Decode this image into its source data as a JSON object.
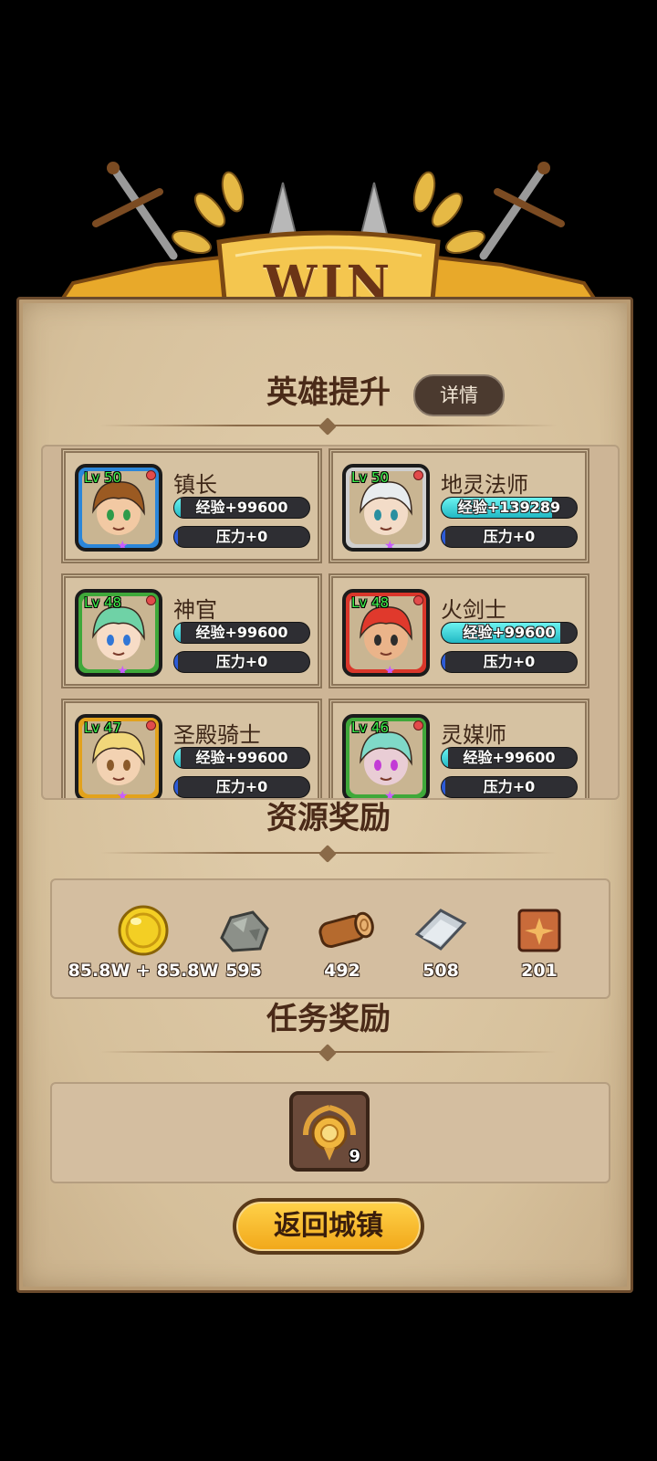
{
  "banner": {
    "title": "WIN"
  },
  "hero_section": {
    "title": "英雄提升",
    "detail_button": "详情",
    "heroes": [
      {
        "name": "镇长",
        "level": "Lv 50",
        "exp": "经验+99600",
        "exp_fill": 0.05,
        "pressure": "压力+0",
        "frame": "#2b86d9",
        "hair": "#9b5a22",
        "skin": "#f2c9a3",
        "eyes": "#2e9b4a"
      },
      {
        "name": "地灵法师",
        "level": "Lv 50",
        "exp": "经验+139289",
        "exp_fill": 0.82,
        "pressure": "压力+0",
        "frame": "#cfcfcf",
        "hair": "#e8ecef",
        "skin": "#f3dcc8",
        "eyes": "#2a8fa0"
      },
      {
        "name": "神官",
        "level": "Lv 48",
        "exp": "经验+99600",
        "exp_fill": 0.05,
        "pressure": "压力+0",
        "frame": "#3fa83a",
        "hair": "#6fd2a6",
        "skin": "#f7dcc6",
        "eyes": "#3076d6"
      },
      {
        "name": "火剑士",
        "level": "Lv 48",
        "exp": "经验+99600",
        "exp_fill": 0.88,
        "pressure": "压力+0",
        "frame": "#d9362a",
        "hair": "#e0392c",
        "skin": "#eab48a",
        "eyes": "#2d2d2d"
      },
      {
        "name": "圣殿骑士",
        "level": "Lv 47",
        "exp": "经验+99600",
        "exp_fill": 0.05,
        "pressure": "压力+0",
        "frame": "#e2a21c",
        "hair": "#f1d77a",
        "skin": "#f3d2b2",
        "eyes": "#8a5a2a"
      },
      {
        "name": "灵媒师",
        "level": "Lv 46",
        "exp": "经验+99600",
        "exp_fill": 0.05,
        "pressure": "压力+0",
        "frame": "#3fa83a",
        "hair": "#7fd9c8",
        "skin": "#e9cdd5",
        "eyes": "#c33bd6"
      }
    ]
  },
  "resource_section": {
    "title": "资源奖励",
    "items": [
      {
        "icon": "gold-coin-icon",
        "value": "85.8W + 85.8W"
      },
      {
        "icon": "ore-icon",
        "value": "595"
      },
      {
        "icon": "wood-log-icon",
        "value": "492"
      },
      {
        "icon": "steel-plate-icon",
        "value": "508"
      },
      {
        "icon": "scroll-icon",
        "value": "201"
      }
    ]
  },
  "task_section": {
    "title": "任务奖励",
    "reward": {
      "icon": "laurel-medal-icon",
      "count": "9"
    }
  },
  "return_button": "返回城镇",
  "colors": {
    "parchment": "#d9c4a2",
    "banner_gold": "#f1b83a",
    "button_gold": "#ffcc3a",
    "exp_bar": "#35d3dc",
    "pressure_bar": "#2d5bd6"
  }
}
